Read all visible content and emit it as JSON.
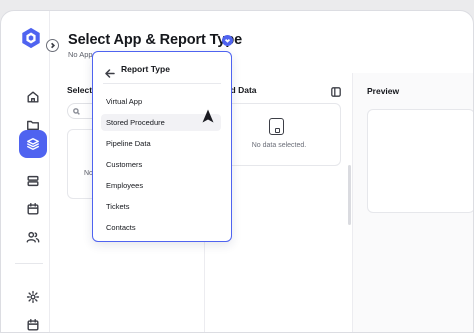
{
  "header": {
    "title": "Select App & Report Type",
    "subtitle": "No App"
  },
  "left_panel": {
    "heading": "Select",
    "placeholder_text": "No"
  },
  "middle_panel": {
    "heading": "ted Data",
    "empty_text": "No data selected."
  },
  "right_panel": {
    "heading": "Preview"
  },
  "dropdown": {
    "title": "Report Type",
    "items": [
      {
        "label": "Virtual App"
      },
      {
        "label": "Stored Procedure"
      },
      {
        "label": "Pipeline Data"
      },
      {
        "label": "Customers"
      },
      {
        "label": "Employees"
      },
      {
        "label": "Tickets"
      },
      {
        "label": "Contacts"
      }
    ],
    "hovered_item": "Stored Procedure"
  },
  "sidebar": {
    "items": [
      {
        "icon": "home-icon"
      },
      {
        "icon": "folder-icon"
      },
      {
        "icon": "layers-icon",
        "active": true
      },
      {
        "icon": "server-icon"
      },
      {
        "icon": "calendar-icon"
      },
      {
        "icon": "users-icon"
      },
      {
        "icon": "settings-icon"
      },
      {
        "icon": "calendar-bottom-icon"
      }
    ]
  },
  "colors": {
    "accent": "#4f63f0",
    "text": "#15171c",
    "muted": "#5b5e68",
    "border": "#e6e7eb",
    "background": "#ebebed"
  }
}
